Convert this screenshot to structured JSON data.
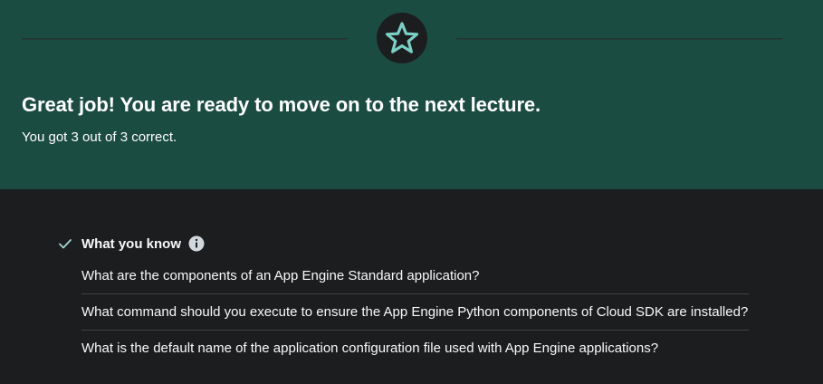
{
  "banner": {
    "title": "Great job! You are ready to move on to the next lecture.",
    "subtitle": "You got 3 out of 3 correct.",
    "badge_icon": "star-icon",
    "badge_color": "#79d0c5",
    "background": "#1b4c42"
  },
  "knowledge": {
    "title": "What you know",
    "status_icon": "check-icon",
    "info_icon": "info-icon",
    "questions": [
      "What are the components of an App Engine Standard application?",
      "What command should you execute to ensure the App Engine Python components of Cloud SDK are installed?",
      "What is the default name of the application configuration file used with App Engine applications?"
    ]
  }
}
